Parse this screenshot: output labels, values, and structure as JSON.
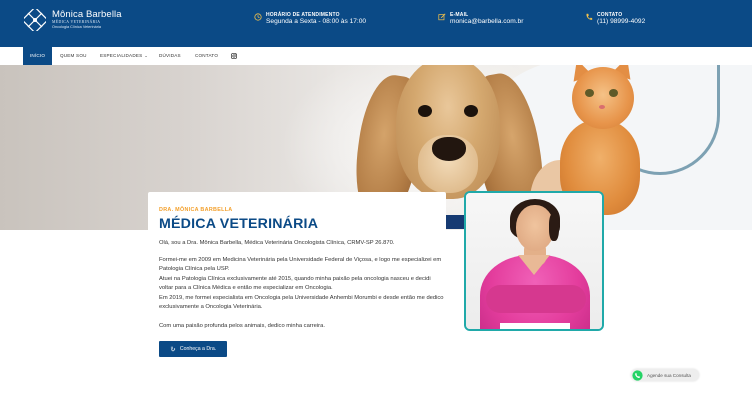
{
  "brand": {
    "name": "Mônica Barbella",
    "subtitle": "MÉDICA VETERINÁRIA",
    "tagline": "Oncologia Clínica Veterinária",
    "primary_color": "#0b4a86",
    "accent_color": "#f3a02c",
    "frame_color": "#20a9a9"
  },
  "header": {
    "hours": {
      "icon": "clock-icon",
      "label": "HORÁRIO DE ATENDIMENTO",
      "value": "Segunda a Sexta - 08:00 às 17:00"
    },
    "email": {
      "icon": "edit-icon",
      "label": "E-MAIL",
      "value": "monica@barbella.com.br"
    },
    "contact": {
      "icon": "phone-icon",
      "label": "CONTATO",
      "value": "(11) 98999-4092"
    }
  },
  "nav": {
    "items": [
      "INÍCIO",
      "QUEM SOU",
      "ESPECIALIDADES",
      "DÚVIDAS",
      "CONTATO"
    ],
    "active": "INÍCIO",
    "social_icon": "instagram-icon"
  },
  "intro": {
    "eyebrow": "DRA. MÔNICA BARBELLA",
    "title": "MÉDICA VETERINÁRIA",
    "p1": "Olá, sou a Dra. Mônica Barbella, Médica Veterinária Oncologista Clínica, CRMV-SP 26.870.",
    "p2": "Formei-me em 2009 em Medicina Veterinária pela Universidade Federal de Viçosa, e logo me especializei em Patologia Clínica pela USP.\nAtuei na Patologia Clínica exclusivamente até 2015, quando minha paixão pela oncologia nasceu e decidi voltar para a Clínica Médica e então me especializar em Oncologia.\nEm 2019, me formei especialista em Oncologia pela Universidade Anhembi Morumbi e desde então me dedico exclusivamente a Oncologia Veterinária.",
    "p3": "Com uma paixão profunda pelos animais, dedico minha carreira.",
    "cta": "Conheça a Dra."
  },
  "whatsapp": {
    "label": "Agende sua Consulta",
    "color": "#25d366"
  }
}
